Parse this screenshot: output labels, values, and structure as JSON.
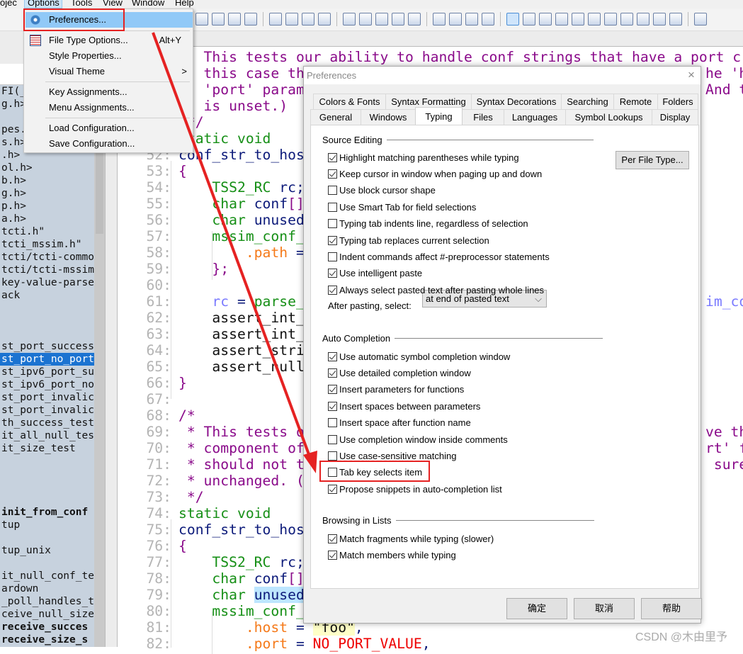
{
  "menubar": {
    "items": [
      "ojec",
      "Options",
      "Tools",
      "View",
      "Window",
      "Help"
    ]
  },
  "toolbar": {
    "icons": [
      "find-down-icon",
      "find-files-icon",
      "replace-xy-icon",
      "web-search-icon",
      "|",
      "bookmark-prev-icon",
      "bookmark-next-icon",
      "indent-list-icon",
      "bookmark-star-icon",
      "|",
      "hand-icon",
      "help-context-icon",
      "book-icon",
      "function-up-icon",
      "r-logo-icon",
      "|",
      "tile-icon",
      "list-icon",
      "split-icon",
      "windows-icon",
      "|",
      "project-p-icon",
      "frame-icon",
      "tree-icon",
      "symbol-s-icon",
      "pieces-icon",
      "help-window-icon",
      "copy-icon",
      "globe-icon",
      "bird-icon",
      "merge-icon",
      "compare-icon",
      "|",
      "plus-icon"
    ]
  },
  "options_menu": {
    "items": [
      {
        "label": "Preferences...",
        "icon": "gear-icon",
        "highlighted": true
      },
      {
        "label": "File Type Options...",
        "shortcut": "Alt+Y",
        "icon": "list-icon"
      },
      {
        "label": "Style Properties..."
      },
      {
        "label": "Visual Theme",
        "submenu": ">"
      },
      {
        "label": "Key Assignments..."
      },
      {
        "label": "Menu Assignments..."
      },
      {
        "label": "Load Configuration..."
      },
      {
        "label": "Save Configuration..."
      }
    ]
  },
  "symbols": [
    {
      "t": "FI(_"
    },
    {
      "t": "g.h>"
    },
    {
      "t": ""
    },
    {
      "t": "pes."
    },
    {
      "t": "s.h>"
    },
    {
      "t": ".h>"
    },
    {
      "t": "ol.h>"
    },
    {
      "t": "b.h>"
    },
    {
      "t": "g.h>"
    },
    {
      "t": "p.h>"
    },
    {
      "t": "a.h>"
    },
    {
      "t": "tcti.h\""
    },
    {
      "t": "tcti_mssim.h\""
    },
    {
      "t": "tcti/tcti-commo"
    },
    {
      "t": "tcti/tcti-mssim"
    },
    {
      "t": "key-value-parse"
    },
    {
      "t": "ack"
    },
    {
      "t": ""
    },
    {
      "t": ""
    },
    {
      "t": ""
    },
    {
      "t": "st_port_success"
    },
    {
      "t": "st_port_no_port",
      "selected": true
    },
    {
      "t": "st_ipv6_port_su"
    },
    {
      "t": "st_ipv6_port_no"
    },
    {
      "t": "st_port_invalic"
    },
    {
      "t": "st_port_invalic"
    },
    {
      "t": "th_success_test"
    },
    {
      "t": "it_all_null_tes"
    },
    {
      "t": "it_size_test"
    },
    {
      "t": ""
    },
    {
      "t": ""
    },
    {
      "t": ""
    },
    {
      "t": ""
    },
    {
      "t": "init_from_conf",
      "bold": true
    },
    {
      "t": "tup"
    },
    {
      "t": ""
    },
    {
      "t": "tup_unix"
    },
    {
      "t": ""
    },
    {
      "t": "it_null_conf_te"
    },
    {
      "t": "ardown"
    },
    {
      "t": "_poll_handles_t"
    },
    {
      "t": "ceive_null_size"
    },
    {
      "t": "receive_succes",
      "bold": true
    },
    {
      "t": "receive_size_s",
      "bold": true
    }
  ],
  "code": {
    "top_lines": [
      {
        "tokens": [
          [
            "   This tests our ability to handle conf strings that have a port c",
            "comment"
          ]
        ]
      },
      {
        "tokens": [
          [
            "   this case th",
            "comment"
          ]
        ],
        "tail": [
          [
            "he 'h",
            "comment"
          ]
        ]
      },
      {
        "tokens": [
          [
            "   'port' param",
            "comment"
          ]
        ],
        "tail": [
          [
            "And t",
            "comment"
          ]
        ]
      },
      {
        "tokens": [
          [
            "   is unset.)",
            "comment"
          ]
        ]
      },
      {
        "tokens": [
          [
            " */",
            "comment"
          ]
        ]
      },
      {
        "tokens": [
          [
            "static void",
            "type"
          ]
        ]
      }
    ],
    "lines": [
      {
        "num": "52:",
        "tokens": [
          [
            "conf_str_to_hos",
            "id"
          ]
        ]
      },
      {
        "num": "53:",
        "tokens": [
          [
            "{",
            "punct"
          ]
        ]
      },
      {
        "num": "54:",
        "tokens": [
          [
            "    ",
            "plain"
          ],
          [
            "TSS2_RC",
            "type"
          ],
          [
            " rc;",
            "id"
          ]
        ]
      },
      {
        "num": "55:",
        "tokens": [
          [
            "    ",
            "plain"
          ],
          [
            "char",
            "type"
          ],
          [
            " conf",
            "id"
          ],
          [
            "[]",
            "punct"
          ]
        ]
      },
      {
        "num": "56:",
        "tokens": [
          [
            "    ",
            "plain"
          ],
          [
            "char",
            "type"
          ],
          [
            " unused",
            "id"
          ]
        ]
      },
      {
        "num": "57:",
        "tokens": [
          [
            "    mssim_conf_",
            "type"
          ]
        ]
      },
      {
        "num": "58:",
        "tokens": [
          [
            "        ",
            "plain"
          ],
          [
            ".path",
            "field"
          ],
          [
            " =",
            "id"
          ]
        ]
      },
      {
        "num": "59:",
        "tokens": [
          [
            "    };",
            "punct"
          ]
        ]
      },
      {
        "num": "60:",
        "tokens": []
      },
      {
        "num": "61:",
        "tokens": [
          [
            "    ",
            "plain"
          ],
          [
            "rc",
            "var"
          ],
          [
            " = ",
            "id"
          ],
          [
            "parse_",
            "type"
          ]
        ],
        "tail": [
          [
            "im_co",
            "var"
          ]
        ]
      },
      {
        "num": "62:",
        "tokens": [
          [
            "    assert_int_",
            "plain"
          ]
        ]
      },
      {
        "num": "63:",
        "tokens": [
          [
            "    assert_int_",
            "plain"
          ]
        ]
      },
      {
        "num": "64:",
        "tokens": [
          [
            "    assert_stri",
            "plain"
          ]
        ]
      },
      {
        "num": "65:",
        "tokens": [
          [
            "    assert_null",
            "plain"
          ]
        ]
      },
      {
        "num": "66:",
        "tokens": [
          [
            "}",
            "punct"
          ]
        ]
      },
      {
        "num": "67:",
        "tokens": []
      },
      {
        "num": "68:",
        "tokens": [
          [
            "/*",
            "comment"
          ]
        ]
      },
      {
        "num": "69:",
        "tokens": [
          [
            " * This tests o",
            "comment"
          ]
        ],
        "tail": [
          [
            "ve th",
            "comment"
          ]
        ]
      },
      {
        "num": "70:",
        "tokens": [
          [
            " * component of",
            "comment"
          ]
        ],
        "tail": [
          [
            "rt' f",
            "comment"
          ]
        ]
      },
      {
        "num": "71:",
        "tokens": [
          [
            " * should not t",
            "comment"
          ]
        ],
        "tail": [
          [
            " sure",
            "comment"
          ]
        ]
      },
      {
        "num": "72:",
        "tokens": [
          [
            " * unchanged. (",
            "comment"
          ]
        ]
      },
      {
        "num": "73:",
        "tokens": [
          [
            " */",
            "comment"
          ]
        ]
      },
      {
        "num": "74:",
        "tokens": [
          [
            "static void",
            "type"
          ]
        ]
      },
      {
        "num": "75:",
        "tokens": [
          [
            "conf_str_to_hos",
            "id"
          ]
        ]
      },
      {
        "num": "76:",
        "tokens": [
          [
            "{",
            "punct"
          ]
        ]
      },
      {
        "num": "77:",
        "tokens": [
          [
            "    ",
            "plain"
          ],
          [
            "TSS2_RC",
            "type"
          ],
          [
            " rc;",
            "id"
          ]
        ]
      },
      {
        "num": "78:",
        "tokens": [
          [
            "    ",
            "plain"
          ],
          [
            "char",
            "type"
          ],
          [
            " conf",
            "id"
          ],
          [
            "[]",
            "punct"
          ]
        ]
      },
      {
        "num": "79:",
        "tokens": [
          [
            "    ",
            "plain"
          ],
          [
            "char",
            "type"
          ],
          [
            " ",
            "plain"
          ],
          [
            "unused",
            "hl"
          ]
        ]
      },
      {
        "num": "80:",
        "tokens": [
          [
            "    mssim_conf_",
            "type"
          ]
        ]
      },
      {
        "num": "81:",
        "tokens": [
          [
            "        ",
            "plain"
          ],
          [
            ".host",
            "field"
          ],
          [
            " = ",
            "id"
          ],
          [
            "\"foo\"",
            "str"
          ],
          [
            ",",
            "id"
          ]
        ]
      },
      {
        "num": "82:",
        "tokens": [
          [
            "        ",
            "plain"
          ],
          [
            ".port",
            "field"
          ],
          [
            " = ",
            "id"
          ],
          [
            "NO_PORT_VALUE",
            "red"
          ],
          [
            ",",
            "id"
          ]
        ]
      }
    ]
  },
  "dialog": {
    "title": "Preferences",
    "close": "×",
    "tabs_row1": [
      "Colors & Fonts",
      "Syntax Formatting",
      "Syntax Decorations",
      "Searching",
      "Remote",
      "Folders"
    ],
    "tabs_row2": [
      "General",
      "Windows",
      "Typing",
      "Files",
      "Languages",
      "Symbol Lookups",
      "Display"
    ],
    "active_tab": "Typing",
    "per_file_type": "Per File Type...",
    "source_editing": {
      "title": "Source Editing",
      "options": [
        {
          "label": "Highlight matching parentheses while typing",
          "checked": true
        },
        {
          "label": "Keep cursor in window when paging up and down",
          "checked": true
        },
        {
          "label": "Use block cursor shape",
          "checked": false
        },
        {
          "label": "Use Smart Tab for field selections",
          "checked": false
        },
        {
          "label": "Typing tab indents line, regardless of selection",
          "checked": false
        },
        {
          "label": "Typing tab replaces current selection",
          "checked": true
        },
        {
          "label": "Indent commands affect #-preprocessor statements",
          "checked": false
        },
        {
          "label": "Use intelligent paste",
          "checked": true
        },
        {
          "label": "Always select pasted text after pasting whole lines",
          "checked": true
        }
      ],
      "after_pasting_label": "After pasting, select:",
      "after_pasting_value": "at end of pasted text"
    },
    "auto_completion": {
      "title": "Auto Completion",
      "options": [
        {
          "label": "Use automatic symbol completion window",
          "checked": true
        },
        {
          "label": "Use detailed completion window",
          "checked": true
        },
        {
          "label": "Insert parameters for functions",
          "checked": true
        },
        {
          "label": "Insert spaces between parameters",
          "checked": true
        },
        {
          "label": "Insert space after function name",
          "checked": false
        },
        {
          "label": "Use completion window inside comments",
          "checked": false
        },
        {
          "label": "Use case-sensitive matching",
          "checked": false
        },
        {
          "label": "Tab key selects item",
          "checked": false
        },
        {
          "label": "Propose snippets in auto-completion list",
          "checked": true
        }
      ]
    },
    "browsing": {
      "title": "Browsing in Lists",
      "options": [
        {
          "label": "Match fragments while typing (slower)",
          "checked": true
        },
        {
          "label": "Match members while typing",
          "checked": true
        }
      ]
    },
    "buttons": {
      "ok": "确定",
      "cancel": "取消",
      "help": "帮助"
    }
  },
  "annotation_color": "#e52222",
  "watermark": "CSDN @木由里予"
}
